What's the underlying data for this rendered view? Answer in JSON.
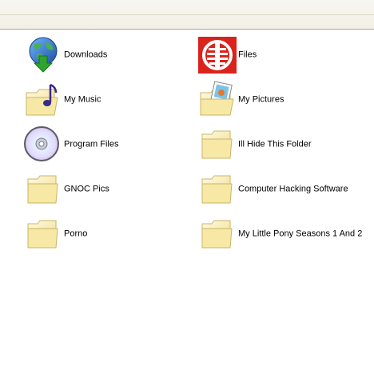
{
  "items": [
    {
      "label": "Downloads",
      "icon": "globe-download-icon"
    },
    {
      "label": "Files",
      "icon": "element-logo-icon"
    },
    {
      "label": "My Music",
      "icon": "music-folder-icon"
    },
    {
      "label": "My Pictures",
      "icon": "pictures-folder-icon"
    },
    {
      "label": "Program Files",
      "icon": "cd-icon"
    },
    {
      "label": "Ill Hide This Folder",
      "icon": "folder-icon"
    },
    {
      "label": "GNOC Pics",
      "icon": "folder-icon"
    },
    {
      "label": "Computer Hacking Software",
      "icon": "folder-icon"
    },
    {
      "label": "Porno",
      "icon": "folder-icon"
    },
    {
      "label": "My Little Pony Seasons 1 And 2",
      "icon": "folder-icon"
    }
  ],
  "colors": {
    "folder_fill": "#f7e9a5",
    "folder_stroke": "#c9b468",
    "download_arrow": "#2ea32e",
    "globe_blue": "#2f76c9",
    "element_red": "#d9231c"
  }
}
